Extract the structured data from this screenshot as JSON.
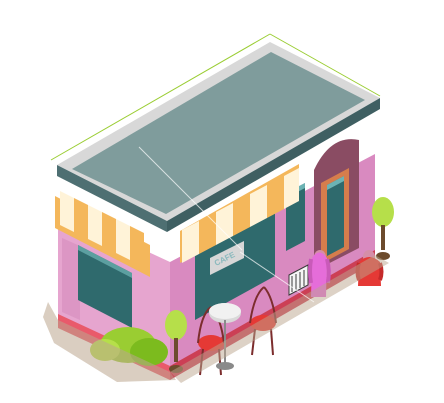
{
  "sign": {
    "text": "CAFE"
  },
  "colors": {
    "background": "#ffffff",
    "roof_top": "#7f9c9c",
    "roof_rim": "#d8d8d8",
    "roof_side": "#4e6f72",
    "wall_left": "#e6a5cf",
    "wall_right": "#d98ac0",
    "base": "#e95a6b",
    "awning_stripe_light": "#fff3d8",
    "awning_stripe_dark": "#f4b75b",
    "window_glass": "#2f6a6d",
    "door_frame": "#d67d4c",
    "chair": "#e53935",
    "table": "#d9d9d9",
    "plant": "#9acd32",
    "person_1": "#e56dd9",
    "person_2": "#e53935"
  }
}
